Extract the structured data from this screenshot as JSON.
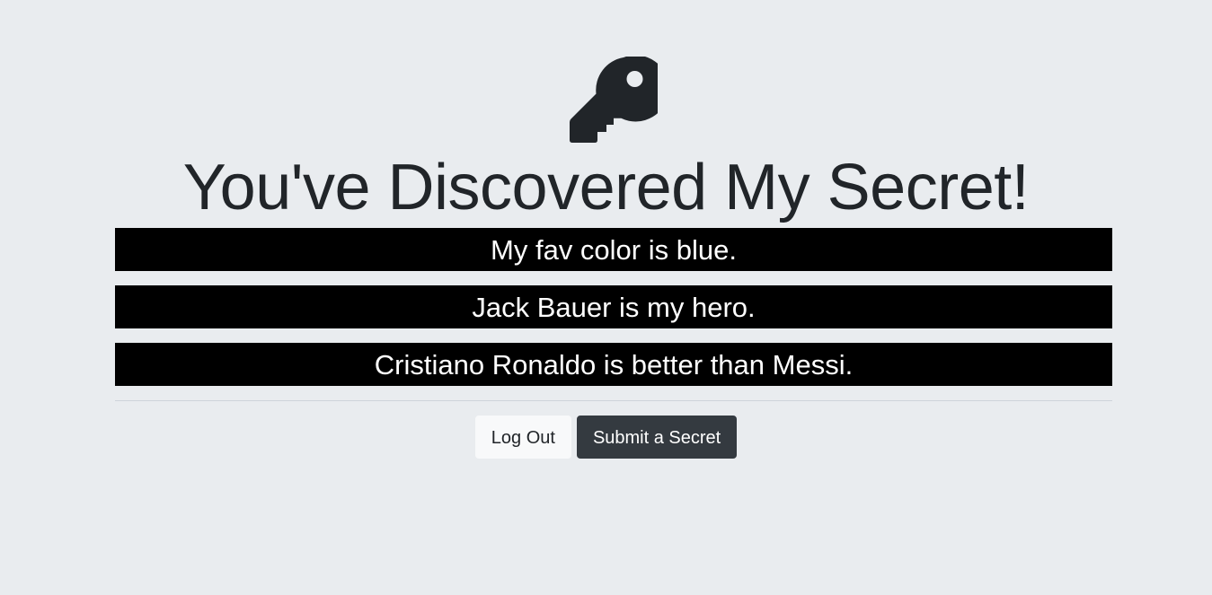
{
  "header": {
    "icon": "key-icon",
    "title": "You've Discovered My Secret!"
  },
  "secrets": [
    "My fav color is blue.",
    "Jack Bauer is my hero.",
    "Cristiano Ronaldo is better than Messi."
  ],
  "actions": {
    "logout_label": "Log Out",
    "submit_label": "Submit a Secret"
  },
  "colors": {
    "background": "#e9ecef",
    "secret_background": "#000000",
    "secret_text": "#ffffff",
    "light_button": "#f8f9fa",
    "dark_button": "#343a40",
    "text": "#212529"
  }
}
